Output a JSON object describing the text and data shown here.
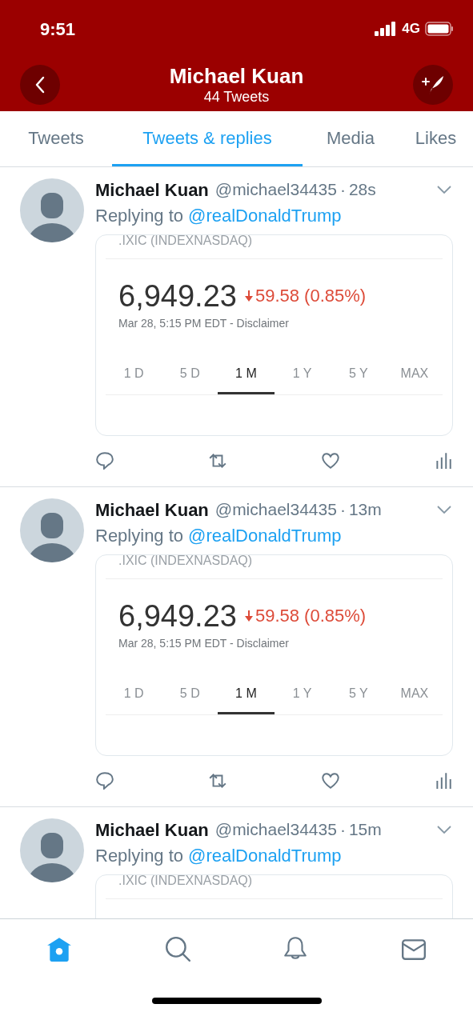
{
  "status_bar": {
    "time": "9:51",
    "network": "4G"
  },
  "header": {
    "title": "Michael Kuan",
    "subtitle": "44 Tweets"
  },
  "tabs": [
    {
      "label": "Tweets",
      "selected": false
    },
    {
      "label": "Tweets & replies",
      "selected": true
    },
    {
      "label": "Media",
      "selected": false
    },
    {
      "label": "Likes",
      "selected": false
    }
  ],
  "tweets": [
    {
      "name": "Michael Kuan",
      "handle": "@michael34435",
      "separator": "·",
      "time": "28s",
      "reply_prefix": "Replying to",
      "reply_to": "@realDonaldTrump",
      "card": {
        "title": ".IXIC (INDEXNASDAQ)",
        "price": "6,949.23",
        "change": "59.58 (0.85%)",
        "meta": "Mar 28, 5:15 PM EDT - Disclaimer",
        "ranges": [
          {
            "label": "1 D",
            "selected": false
          },
          {
            "label": "5 D",
            "selected": false
          },
          {
            "label": "1 M",
            "selected": true
          },
          {
            "label": "1 Y",
            "selected": false
          },
          {
            "label": "5 Y",
            "selected": false
          },
          {
            "label": "MAX",
            "selected": false
          }
        ]
      }
    },
    {
      "name": "Michael Kuan",
      "handle": "@michael34435",
      "separator": "·",
      "time": "13m",
      "reply_prefix": "Replying to",
      "reply_to": "@realDonaldTrump",
      "card": {
        "title": ".IXIC (INDEXNASDAQ)",
        "price": "6,949.23",
        "change": "59.58 (0.85%)",
        "meta": "Mar 28, 5:15 PM EDT - Disclaimer",
        "ranges": [
          {
            "label": "1 D",
            "selected": false
          },
          {
            "label": "5 D",
            "selected": false
          },
          {
            "label": "1 M",
            "selected": true
          },
          {
            "label": "1 Y",
            "selected": false
          },
          {
            "label": "5 Y",
            "selected": false
          },
          {
            "label": "MAX",
            "selected": false
          }
        ]
      }
    },
    {
      "name": "Michael Kuan",
      "handle": "@michael34435",
      "separator": "·",
      "time": "15m",
      "reply_prefix": "Replying to",
      "reply_to": "@realDonaldTrump",
      "card": {
        "title": ".IXIC (INDEXNASDAQ)"
      }
    }
  ],
  "bottom_nav": [
    {
      "kind": "home",
      "selected": true
    },
    {
      "kind": "search",
      "selected": false
    },
    {
      "kind": "notifications",
      "selected": false
    },
    {
      "kind": "messages",
      "selected": false
    }
  ]
}
